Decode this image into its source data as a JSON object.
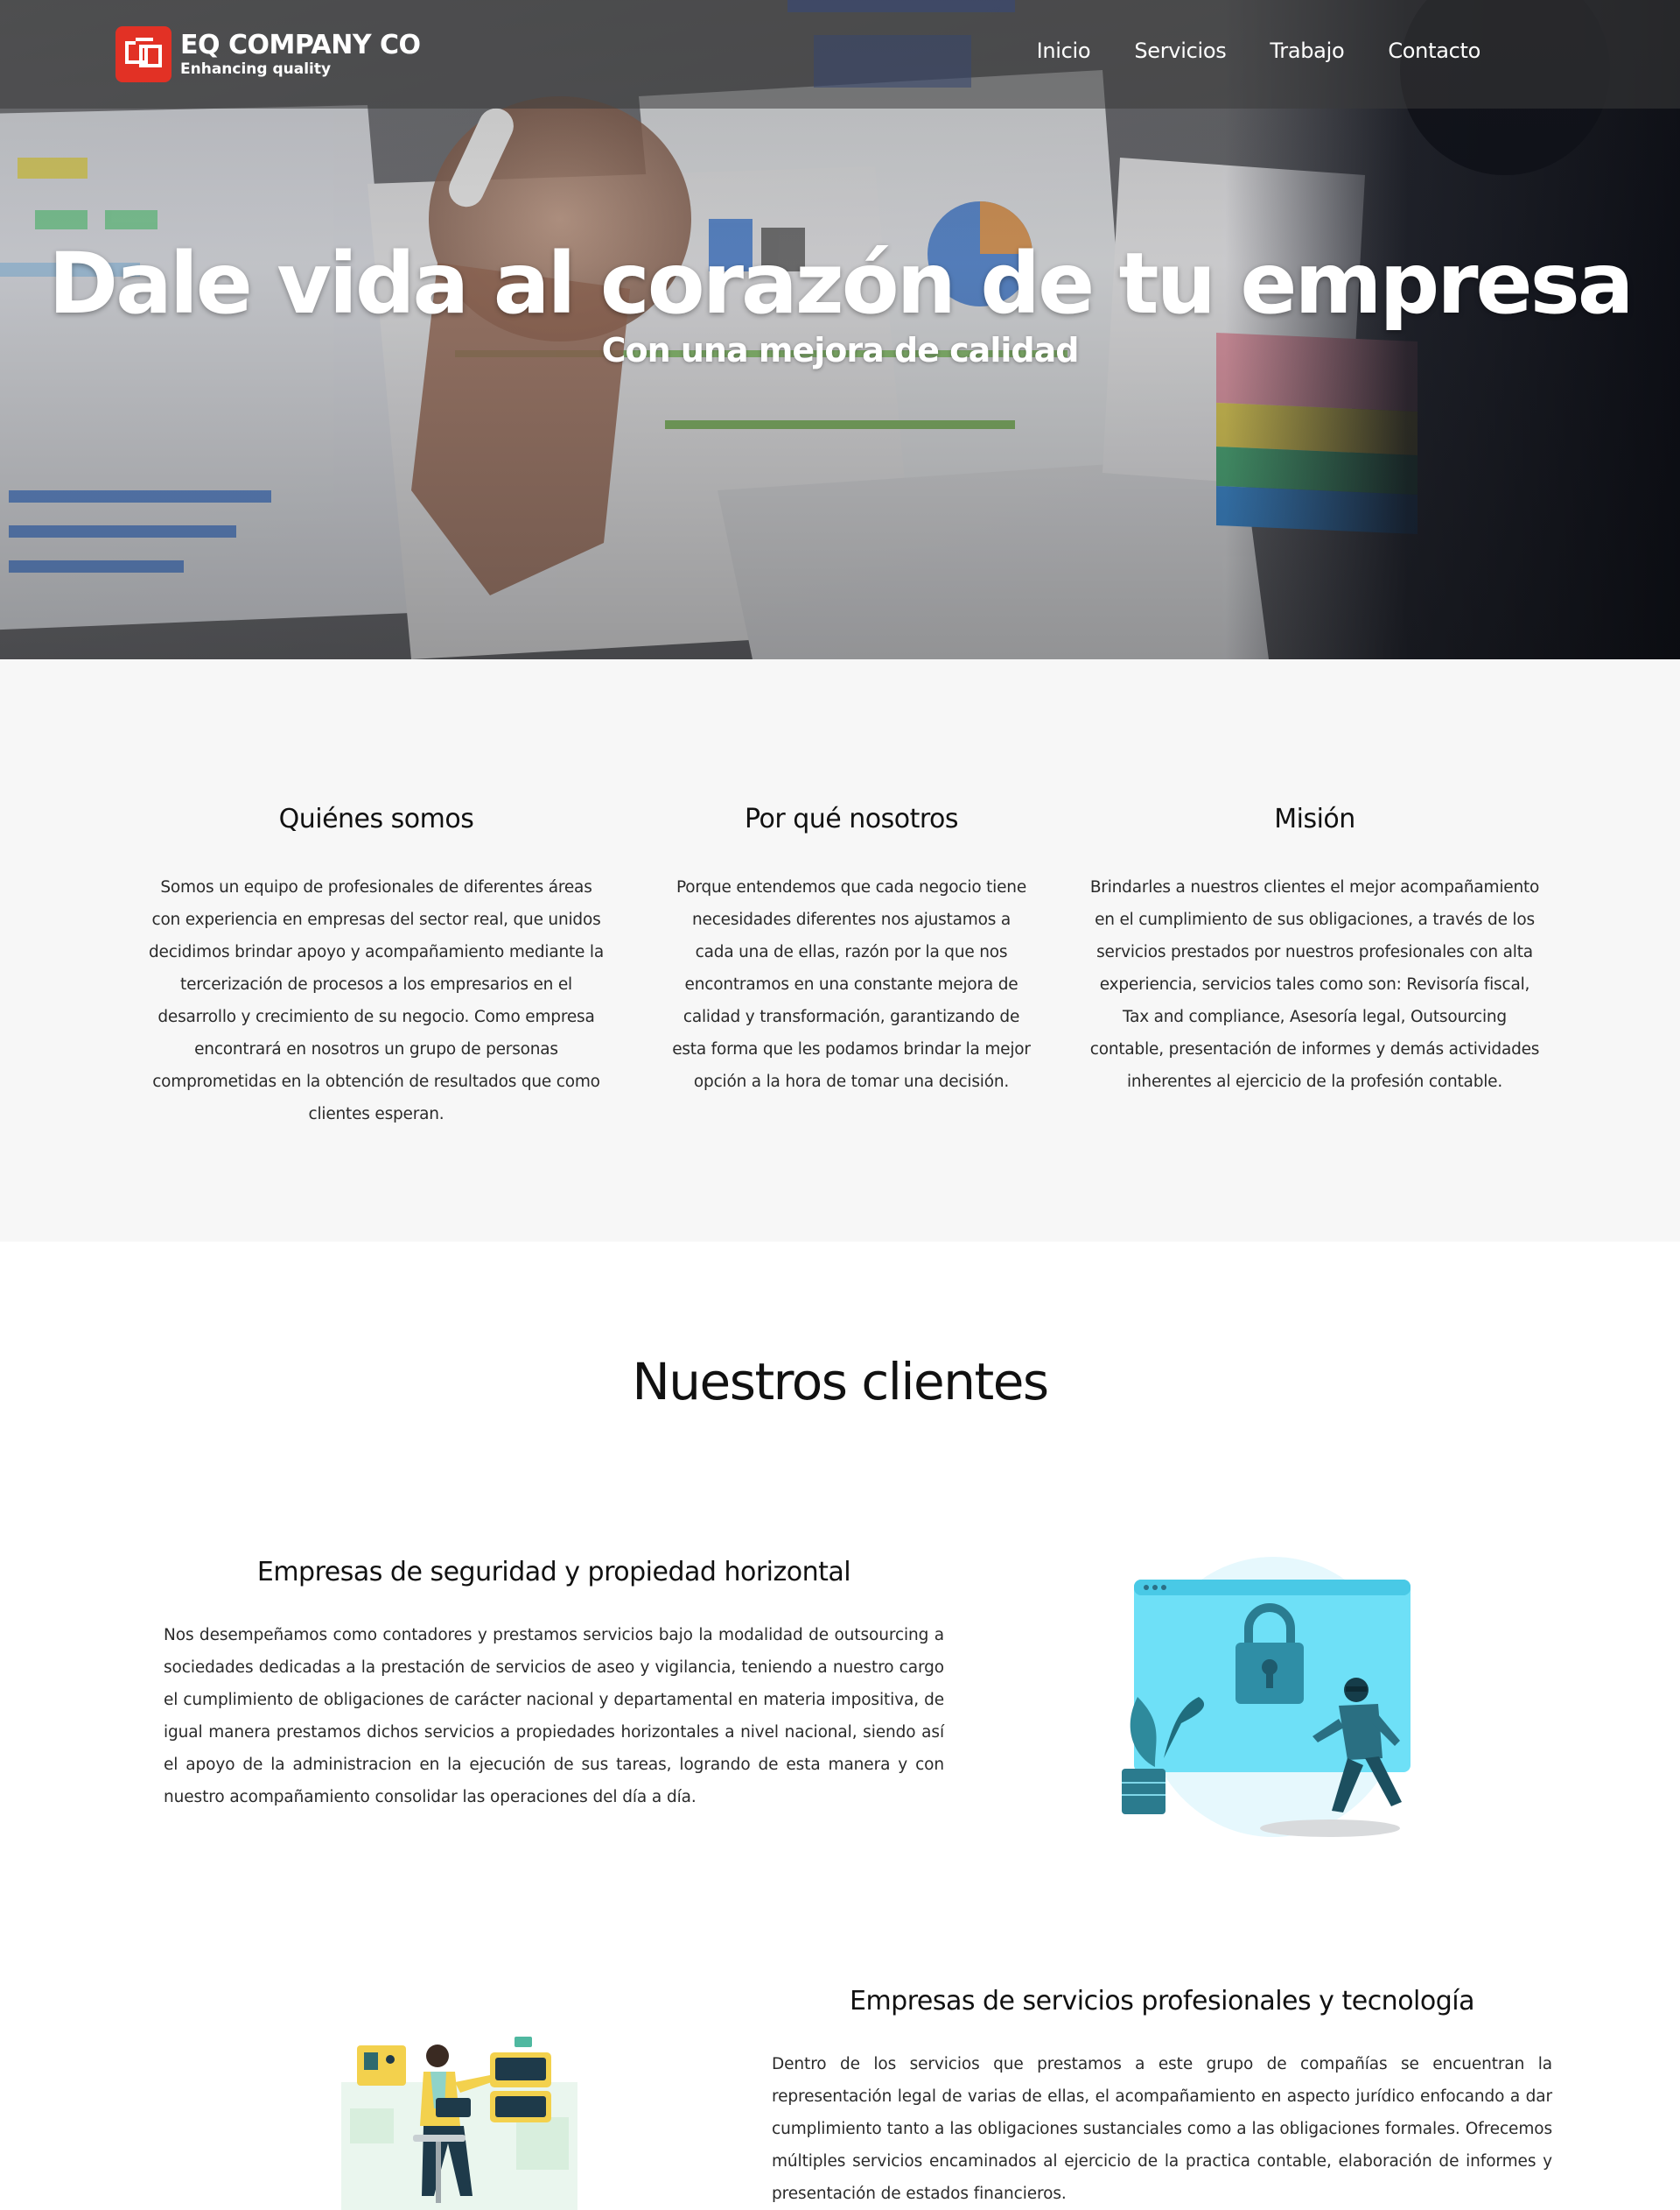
{
  "brand": {
    "name": "EQ COMPANY CO",
    "tagline": "Enhancing quality",
    "accent_color": "#e23125"
  },
  "nav": {
    "items": [
      {
        "label": "Inicio"
      },
      {
        "label": "Servicios"
      },
      {
        "label": "Trabajo"
      },
      {
        "label": "Contacto"
      }
    ]
  },
  "hero": {
    "title": "Dale vida al corazón de tu empresa",
    "subtitle": "Con una mejora de calidad"
  },
  "about": {
    "columns": [
      {
        "title": "Quiénes somos",
        "text": "Somos un equipo de profesionales de diferentes áreas con experiencia en empresas del sector real, que unidos decidimos brindar apoyo y acompañamiento mediante la tercerización de procesos a los empresarios en el desarrollo y crecimiento de su negocio. Como empresa encontrará en nosotros un grupo de personas comprometidas en la obtención de resultados que como clientes esperan."
      },
      {
        "title": "Por qué nosotros",
        "text": "Porque entendemos que cada negocio tiene necesidades diferentes nos ajustamos a cada una de ellas, razón por la que nos encontramos en una constante mejora de calidad y transformación, garantizando de esta forma que les podamos brindar la mejor opción a la hora de tomar una decisión."
      },
      {
        "title": "Misión",
        "text": "Brindarles a nuestros clientes el mejor acompañamiento en el cumplimiento de sus obligaciones, a través de los servicios prestados por nuestros profesionales con alta experiencia, servicios tales como son: Revisoría fiscal, Tax and compliance, Asesoría legal, Outsourcing contable, presentación de informes y demás actividades inherentes al ejercicio de la profesión contable."
      }
    ]
  },
  "clients": {
    "title": "Nuestros clientes",
    "items": [
      {
        "title": "Empresas de seguridad y propiedad horizontal",
        "text": "Nos desempeñamos como contadores y prestamos servicios bajo la modalidad de outsourcing a sociedades dedicadas a la prestación de servicios de aseo y vigilancia, teniendo a nuestro cargo el cumplimiento de obligaciones de carácter nacional y departamental en materia impositiva, de igual manera prestamos dichos servicios a propiedades horizontales a nivel nacional, siendo así el apoyo de la administracion en la ejecución de sus tareas, logrando de esta manera y con nuestro acompañamiento consolidar las operaciones del día a día.",
        "icon": "security-lock-illustration"
      },
      {
        "title": "Empresas de servicios profesionales y tecnología",
        "text": "Dentro de los servicios que prestamos a este grupo de compañías se encuentran la representación legal de varias de ellas, el acompañamiento en aspecto jurídico enfocando a dar cumplimiento tanto a las obligaciones sustanciales como a las obligaciones formales. Ofrecemos múltiples servicios encaminados al ejercicio de la practica contable, elaboración de informes y presentación de estados financieros.",
        "icon": "professional-services-illustration"
      }
    ]
  }
}
